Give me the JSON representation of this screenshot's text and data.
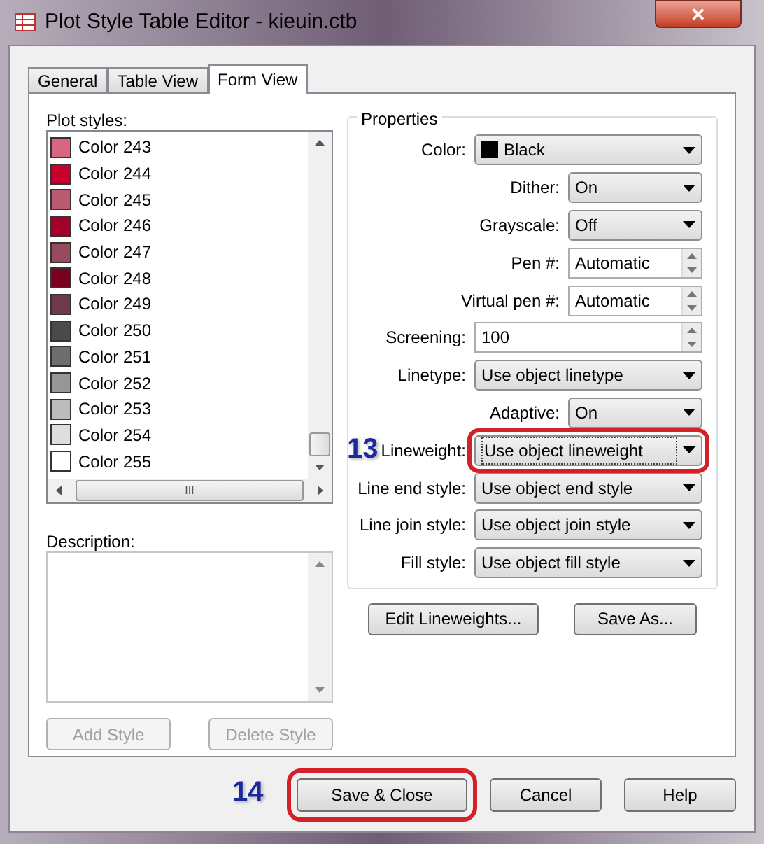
{
  "window": {
    "title": "Plot Style Table Editor - kieuin.ctb",
    "close": "✕"
  },
  "tabs": [
    {
      "label": "General",
      "selected": false
    },
    {
      "label": "Table View",
      "selected": false
    },
    {
      "label": "Form View",
      "selected": true
    }
  ],
  "plot_styles": {
    "label": "Plot styles:",
    "items": [
      {
        "name": "Color 243",
        "color": "#d9667e"
      },
      {
        "name": "Color 244",
        "color": "#c8002e"
      },
      {
        "name": "Color 245",
        "color": "#b95a70"
      },
      {
        "name": "Color 246",
        "color": "#a3002a"
      },
      {
        "name": "Color 247",
        "color": "#984b5c"
      },
      {
        "name": "Color 248",
        "color": "#7a0020"
      },
      {
        "name": "Color 249",
        "color": "#6e3a48"
      },
      {
        "name": "Color 250",
        "color": "#4a4a4a"
      },
      {
        "name": "Color 251",
        "color": "#6e6e6e"
      },
      {
        "name": "Color 252",
        "color": "#969696"
      },
      {
        "name": "Color 253",
        "color": "#bcbcbc"
      },
      {
        "name": "Color 254",
        "color": "#dedede"
      },
      {
        "name": "Color 255",
        "color": "#ffffff"
      }
    ],
    "scroll_grip": "III"
  },
  "description": {
    "label": "Description:"
  },
  "list_buttons": [
    {
      "label": "Add Style",
      "disabled": true
    },
    {
      "label": "Delete Style",
      "disabled": true
    }
  ],
  "properties": {
    "title": "Properties",
    "rows": [
      {
        "label": "Color:",
        "kind": "dropdown",
        "value": "Black",
        "color": "#000000"
      },
      {
        "label": "Dither:",
        "kind": "short_dropdown",
        "value": "On"
      },
      {
        "label": "Grayscale:",
        "kind": "short_dropdown",
        "value": "Off"
      },
      {
        "label": "Pen #:",
        "kind": "short_spinner",
        "value": "Automatic"
      },
      {
        "label": "Virtual pen #:",
        "kind": "short_spinner",
        "value": "Automatic"
      },
      {
        "label": "Screening:",
        "kind": "spinner",
        "value": "100"
      },
      {
        "label": "Linetype:",
        "kind": "dropdown",
        "value": "Use object linetype"
      },
      {
        "label": "Adaptive:",
        "kind": "short_dropdown",
        "value": "On"
      },
      {
        "label": "Lineweight:",
        "kind": "dropdown",
        "value": "Use object lineweight",
        "step": "13"
      },
      {
        "label": "Line end style:",
        "kind": "dropdown",
        "value": "Use object end style"
      },
      {
        "label": "Line join style:",
        "kind": "dropdown",
        "value": "Use object join style"
      },
      {
        "label": "Fill style:",
        "kind": "dropdown",
        "value": "Use object fill style"
      }
    ]
  },
  "property_buttons": [
    "Edit Lineweights...",
    "Save As..."
  ],
  "footer_buttons": [
    {
      "label": "Save & Close",
      "step": "14"
    },
    {
      "label": "Cancel"
    },
    {
      "label": "Help"
    }
  ]
}
